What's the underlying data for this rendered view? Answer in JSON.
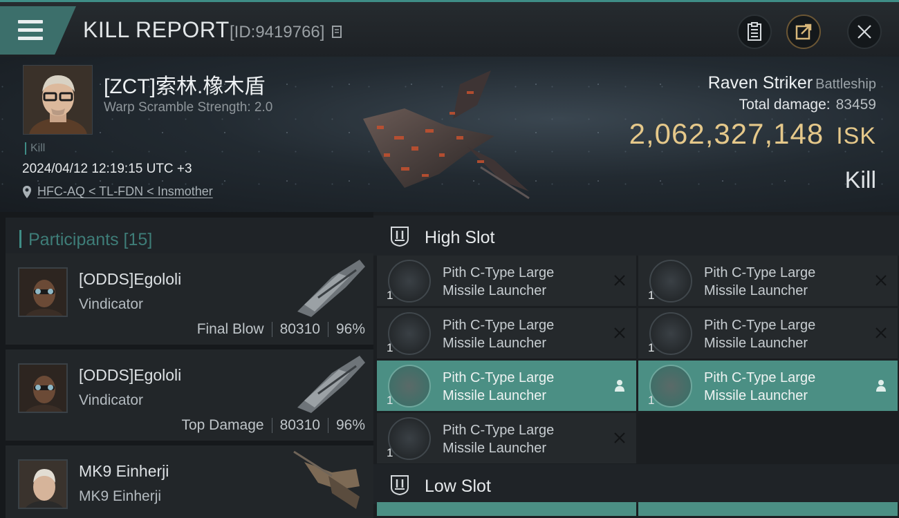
{
  "header": {
    "title": "KILL REPORT",
    "report_id": "[ID:9419766]",
    "menu_icon": "hamburger-menu-icon",
    "buttons": [
      "clipboard-icon",
      "share-icon",
      "close-icon"
    ]
  },
  "victim": {
    "pilot": "[ZCT]索林.橡木盾",
    "warp_scramble": "Warp Scramble Strength: 2.0",
    "tag": "Kill",
    "timestamp": "2024/04/12 12:19:15 UTC +3",
    "location": "HFC-AQ < TL-FDN < Insmother",
    "ship_name": "Raven Striker",
    "ship_class": "Battleship",
    "total_damage_label": "Total damage:",
    "total_damage": "83459",
    "isk_value": "2,062,327,148",
    "isk_unit": "ISK",
    "result": "Kill"
  },
  "participants": {
    "header": "Participants [15]",
    "items": [
      {
        "name": "[ODDS]Egololi",
        "ship": "Vindicator",
        "role": "Final Blow",
        "damage": "80310",
        "percent": "96%"
      },
      {
        "name": "[ODDS]Egololi",
        "ship": "Vindicator",
        "role": "Top Damage",
        "damage": "80310",
        "percent": "96%"
      },
      {
        "name": "MK9 Einherji",
        "ship": "MK9 Einherji",
        "role": "",
        "damage": "",
        "percent": ""
      }
    ]
  },
  "slots": {
    "high": {
      "label": "High Slot",
      "modules": [
        {
          "line1": "Pith C-Type Large",
          "line2": "Missile Launcher",
          "qty": "1",
          "state": "destroyed"
        },
        {
          "line1": "Pith C-Type Large",
          "line2": "Missile Launcher",
          "qty": "1",
          "state": "destroyed"
        },
        {
          "line1": "Pith C-Type Large",
          "line2": "Missile Launcher",
          "qty": "1",
          "state": "destroyed"
        },
        {
          "line1": "Pith C-Type Large",
          "line2": "Missile Launcher",
          "qty": "1",
          "state": "destroyed"
        },
        {
          "line1": "Pith C-Type Large",
          "line2": "Missile Launcher",
          "qty": "1",
          "state": "dropped"
        },
        {
          "line1": "Pith C-Type Large",
          "line2": "Missile Launcher",
          "qty": "1",
          "state": "dropped"
        },
        {
          "line1": "Pith C-Type Large",
          "line2": "Missile Launcher",
          "qty": "1",
          "state": "destroyed"
        }
      ]
    },
    "low": {
      "label": "Low Slot"
    }
  },
  "colors": {
    "accent": "#3f8d86",
    "isk": "#e5c88a",
    "dropped_row": "#4b8f84",
    "panel": "#25292c"
  }
}
